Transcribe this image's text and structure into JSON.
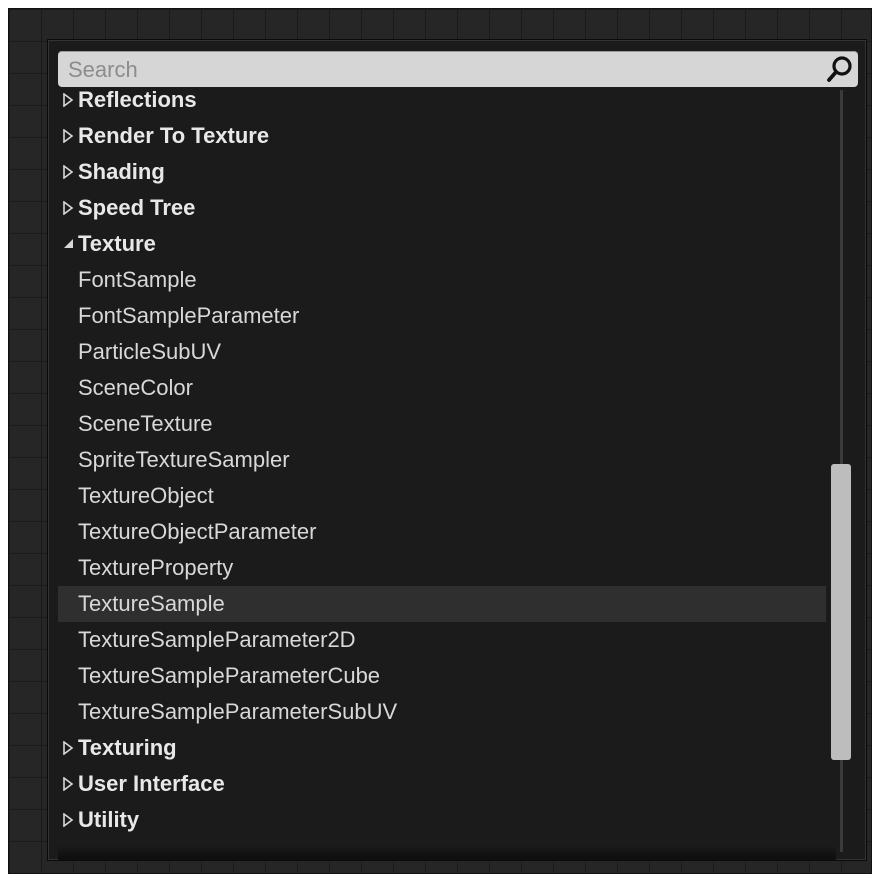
{
  "search": {
    "placeholder": "Search",
    "value": ""
  },
  "list": {
    "rows": [
      {
        "label": "Reflections",
        "kind": "category",
        "expanded": false
      },
      {
        "label": "Render To Texture",
        "kind": "category",
        "expanded": false
      },
      {
        "label": "Shading",
        "kind": "category",
        "expanded": false
      },
      {
        "label": "Speed Tree",
        "kind": "category",
        "expanded": false
      },
      {
        "label": "Texture",
        "kind": "category",
        "expanded": true
      },
      {
        "label": "FontSample",
        "kind": "item"
      },
      {
        "label": "FontSampleParameter",
        "kind": "item"
      },
      {
        "label": "ParticleSubUV",
        "kind": "item"
      },
      {
        "label": "SceneColor",
        "kind": "item"
      },
      {
        "label": "SceneTexture",
        "kind": "item"
      },
      {
        "label": "SpriteTextureSampler",
        "kind": "item"
      },
      {
        "label": "TextureObject",
        "kind": "item"
      },
      {
        "label": "TextureObjectParameter",
        "kind": "item"
      },
      {
        "label": "TextureProperty",
        "kind": "item"
      },
      {
        "label": "TextureSample",
        "kind": "item",
        "selected": true
      },
      {
        "label": "TextureSampleParameter2D",
        "kind": "item"
      },
      {
        "label": "TextureSampleParameterCube",
        "kind": "item"
      },
      {
        "label": "TextureSampleParameterSubUV",
        "kind": "item"
      },
      {
        "label": "Texturing",
        "kind": "category",
        "expanded": false
      },
      {
        "label": "User Interface",
        "kind": "category",
        "expanded": false
      },
      {
        "label": "Utility",
        "kind": "category",
        "expanded": false
      }
    ]
  },
  "colors": {
    "selection": "#2f2f2f",
    "text": "#d8d8d8",
    "scrollbar": "#bdbdbd"
  }
}
